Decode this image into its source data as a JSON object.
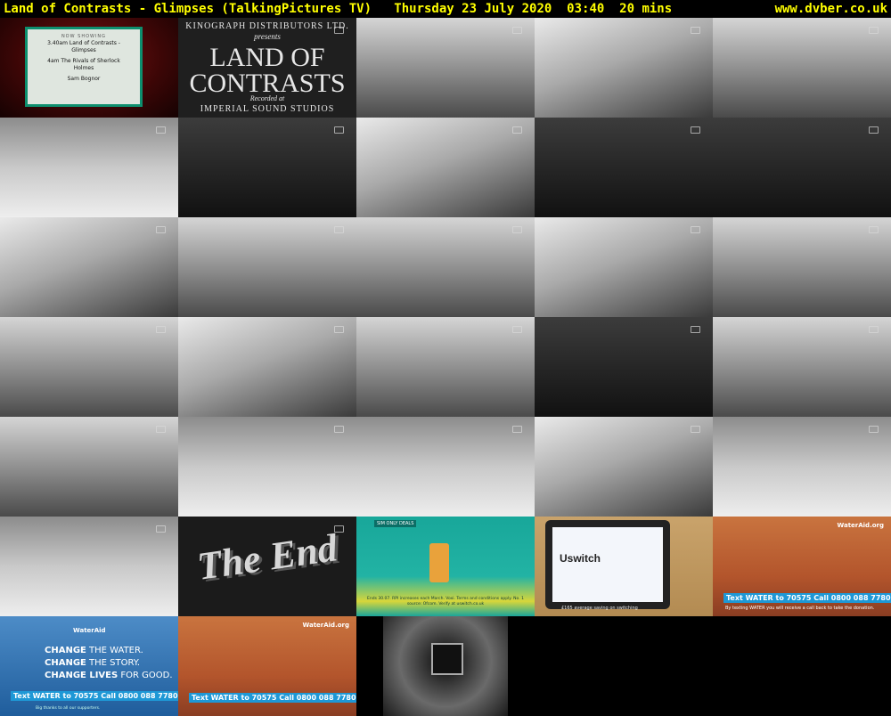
{
  "header": {
    "left": "Land of Contrasts - Glimpses (TalkingPictures TV)   Thursday 23 July 2020  03:40  20 mins",
    "right": "www.dvber.co.uk"
  },
  "thumbnails": {
    "cinema_screen": {
      "now_showing": "NOW SHOWING",
      "line1": "3.40am Land of Contrasts -",
      "line2": "Glimpses",
      "line3": "4am The Rivals of Sherlock",
      "line4": "Holmes",
      "line5": "Sam Bognor"
    },
    "title_card": {
      "distributor": "KINOGRAPH  DISTRIBUTORS LTD.",
      "presents": "presents",
      "title_line1": "LAND OF",
      "title_line2": "CONTRASTS",
      "recorded": "Recorded at",
      "studio": "IMPERIAL SOUND STUDIOS"
    },
    "the_end": {
      "text": "The End"
    },
    "ad_sim": {
      "small_label": "SIM ONLY DEALS",
      "fine_print": "Ends 30.07. RPI increases each March. Voxi. Terms and conditions apply. No. 1 source: Ofcom. Verify at uswitch.co.uk"
    },
    "ad_switch": {
      "logo": "Uswitch",
      "fine_print": "£165 average saving on switching"
    },
    "ad_wateraid_1": {
      "logo": "WaterAid.org",
      "text_line": "Text WATER to 70575  Call 0800 088 7780",
      "fine_print": "By texting WATER you will receive a call back to take the donation."
    },
    "ad_wateraid_2": {
      "logo": "WaterAid",
      "line1_bold": "CHANGE",
      "line1_rest": " THE WATER.",
      "line2_bold": "CHANGE",
      "line2_rest": " THE STORY.",
      "line3_bold": "CHANGE LIVES",
      "line3_rest": " FOR GOOD.",
      "text_line": "Text WATER to 70575  Call 0800 088 7780",
      "fine_print": "Big thanks to all our supporters."
    },
    "ad_wateraid_3": {
      "logo": "WaterAid.org",
      "text_line": "Text WATER to 70575  Call 0800 088 7780"
    }
  }
}
